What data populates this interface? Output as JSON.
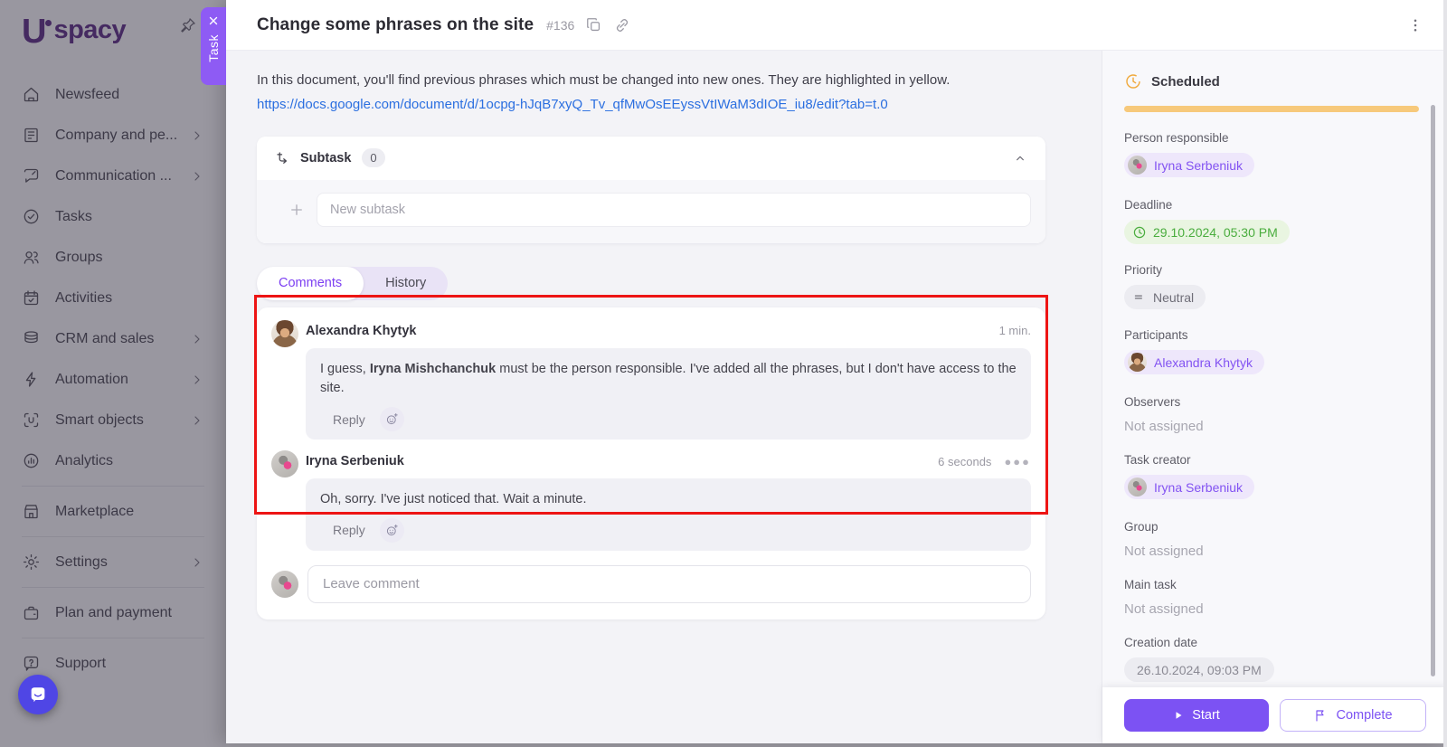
{
  "colors": {
    "accent_purple": "#7c52f3",
    "task_tab_purple": "#8e5bf4",
    "status_bar_orange": "#f7c97b",
    "deadline_green": "#4aad3e",
    "annotation_red": "#ed1414",
    "link_blue": "#2b6fe0"
  },
  "sidebar": {
    "logo_text": "spacy",
    "logo_letter": "U",
    "items": [
      {
        "label": "Newsfeed",
        "icon": "newsfeed-icon",
        "has_submenu": false
      },
      {
        "label": "Company and pe...",
        "icon": "company-icon",
        "has_submenu": true
      },
      {
        "label": "Communication ...",
        "icon": "communication-icon",
        "has_submenu": true
      },
      {
        "label": "Tasks",
        "icon": "tasks-icon",
        "has_submenu": false
      },
      {
        "label": "Groups",
        "icon": "groups-icon",
        "has_submenu": false
      },
      {
        "label": "Activities",
        "icon": "activities-icon",
        "has_submenu": false
      },
      {
        "label": "CRM and sales",
        "icon": "crm-icon",
        "has_submenu": true
      },
      {
        "label": "Automation",
        "icon": "automation-icon",
        "has_submenu": true
      },
      {
        "label": "Smart objects",
        "icon": "smart-objects-icon",
        "has_submenu": true
      },
      {
        "label": "Analytics",
        "icon": "analytics-icon",
        "has_submenu": false
      },
      {
        "label": "Marketplace",
        "icon": "marketplace-icon",
        "has_submenu": false
      },
      {
        "label": "Settings",
        "icon": "settings-icon",
        "has_submenu": true
      },
      {
        "label": "Plan and payment",
        "icon": "plan-payment-icon",
        "has_submenu": false
      },
      {
        "label": "Support",
        "icon": "support-icon",
        "has_submenu": false
      }
    ]
  },
  "task_drawer": {
    "tab_label": "Task",
    "title": "Change some phrases on the site",
    "task_number": "#136",
    "description": "In this document, you'll find previous phrases which must be changed into new ones. They are highlighted in yellow.",
    "link_url": "https://docs.google.com/document/d/1ocpg-hJqB7xyQ_Tv_qfMwOsEEyssVtIWaM3dIOE_iu8/edit?tab=t.0"
  },
  "subtask_section": {
    "title": "Subtask",
    "count": "0",
    "new_subtask_placeholder": "New subtask"
  },
  "activity_tabs": {
    "comments_label": "Comments",
    "history_label": "History",
    "active_tab": "Comments"
  },
  "comments": {
    "items": [
      {
        "author": "Alexandra Khytyk",
        "time": "1 min.",
        "text_prefix": "I guess, ",
        "mention": "Iryna Mishchanchuk",
        "text_suffix": " must be the person responsible. I've added all the phrases, but I don't have access to the site.",
        "reply_label": "Reply"
      },
      {
        "author": "Iryna Serbeniuk",
        "time": "6 seconds",
        "text": "Oh, sorry. I've just noticed that. Wait a minute.",
        "reply_label": "Reply"
      }
    ],
    "leave_comment_placeholder": "Leave comment"
  },
  "details_panel": {
    "status_label": "Scheduled",
    "person_responsible": {
      "label": "Person responsible",
      "value": "Iryna Serbeniuk"
    },
    "deadline": {
      "label": "Deadline",
      "value": "29.10.2024, 05:30 PM"
    },
    "priority": {
      "label": "Priority",
      "value": "Neutral"
    },
    "participants": {
      "label": "Participants",
      "value": "Alexandra Khytyk"
    },
    "observers": {
      "label": "Observers",
      "value": "Not assigned"
    },
    "task_creator": {
      "label": "Task creator",
      "value": "Iryna Serbeniuk"
    },
    "group": {
      "label": "Group",
      "value": "Not assigned"
    },
    "main_task": {
      "label": "Main task",
      "value": "Not assigned"
    },
    "creation_date": {
      "label": "Creation date",
      "value": "26.10.2024, 09:03 PM"
    }
  },
  "footer_actions": {
    "start_label": "Start",
    "complete_label": "Complete"
  }
}
